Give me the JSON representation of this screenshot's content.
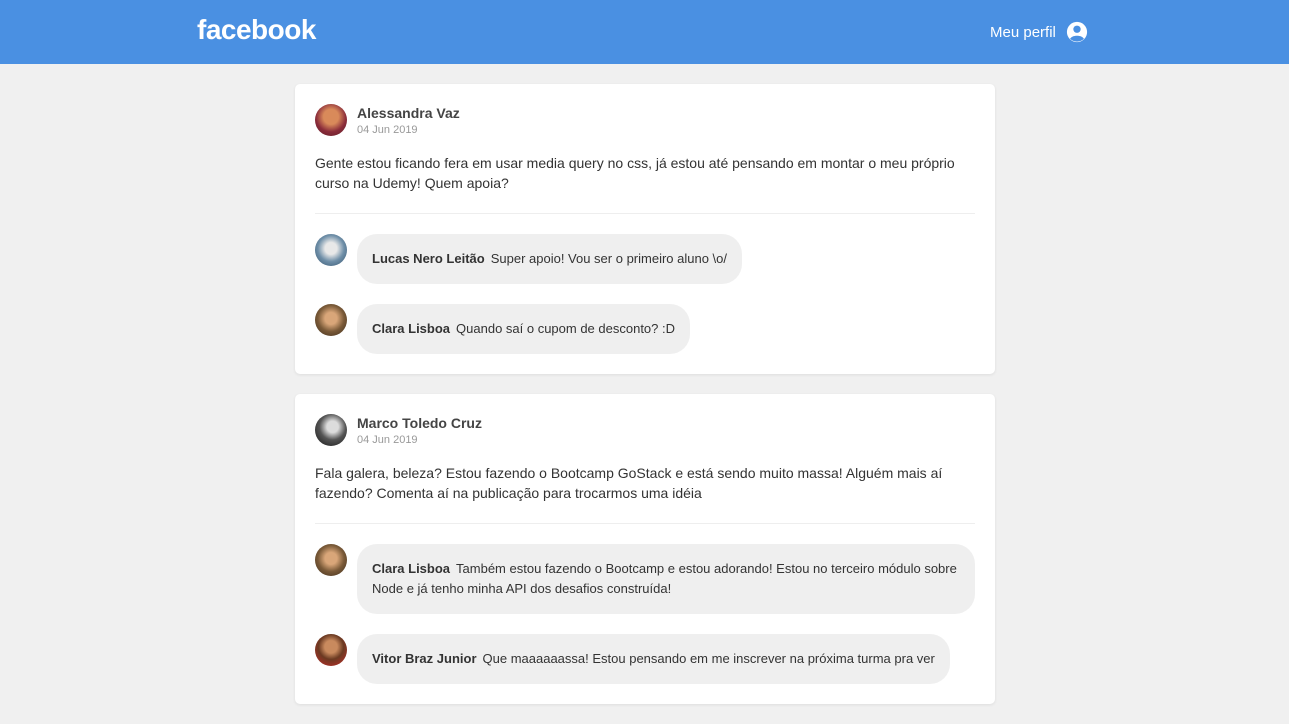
{
  "header": {
    "logo": "facebook",
    "profile_label": "Meu perfil",
    "profile_icon": "user-circle-icon",
    "bg_color": "#4a90e2"
  },
  "posts": [
    {
      "author": "Alessandra Vaz",
      "date": "04 Jun 2019",
      "content": "Gente estou ficando fera em usar media query no css, já estou até pensando em montar o meu próprio curso na Udemy! Quem apoia?",
      "comments": [
        {
          "author": "Lucas Nero Leitão",
          "text": "Super apoio! Vou ser o primeiro aluno \\o/"
        },
        {
          "author": "Clara Lisboa",
          "text": "Quando saí o cupom de desconto? :D"
        }
      ]
    },
    {
      "author": "Marco Toledo Cruz",
      "date": "04 Jun 2019",
      "content": "Fala galera, beleza? Estou fazendo o Bootcamp GoStack e está sendo muito massa! Alguém mais aí fazendo? Comenta aí na publicação para trocarmos uma idéia",
      "comments": [
        {
          "author": "Clara Lisboa",
          "text": "Também estou fazendo o Bootcamp e estou adorando! Estou no terceiro módulo sobre Node e já tenho minha API dos desafios construída!"
        },
        {
          "author": "Vitor Braz Junior",
          "text": "Que maaaaaassa! Estou pensando em me inscrever na próxima turma pra ver"
        }
      ]
    }
  ]
}
